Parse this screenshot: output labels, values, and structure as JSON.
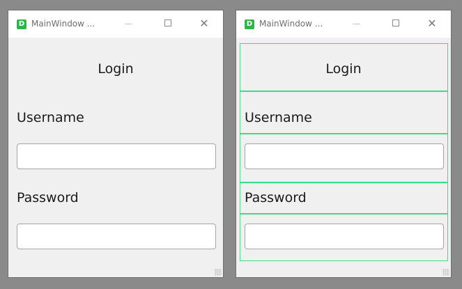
{
  "windows": [
    {
      "title": "MainWindow ...",
      "app_icon_letter": "D",
      "heading": "Login",
      "username_label": "Username",
      "username_value": "",
      "password_label": "Password",
      "password_value": "",
      "close_glyph": "✕"
    },
    {
      "title": "MainWindow ...",
      "app_icon_letter": "D",
      "heading": "Login",
      "username_label": "Username",
      "username_value": "",
      "password_label": "Password",
      "password_value": "",
      "close_glyph": "✕"
    }
  ],
  "icons": {
    "app": "app-logo-icon",
    "minimize": "minimize-icon",
    "maximize": "maximize-icon",
    "close": "close-icon",
    "resize": "resize-grip-icon"
  },
  "colors": {
    "app_icon": "#2fb34a",
    "layout_outline": "#3ddc8a",
    "window_bg": "#f0f0f0",
    "desktop_bg": "#8a8a8a"
  }
}
